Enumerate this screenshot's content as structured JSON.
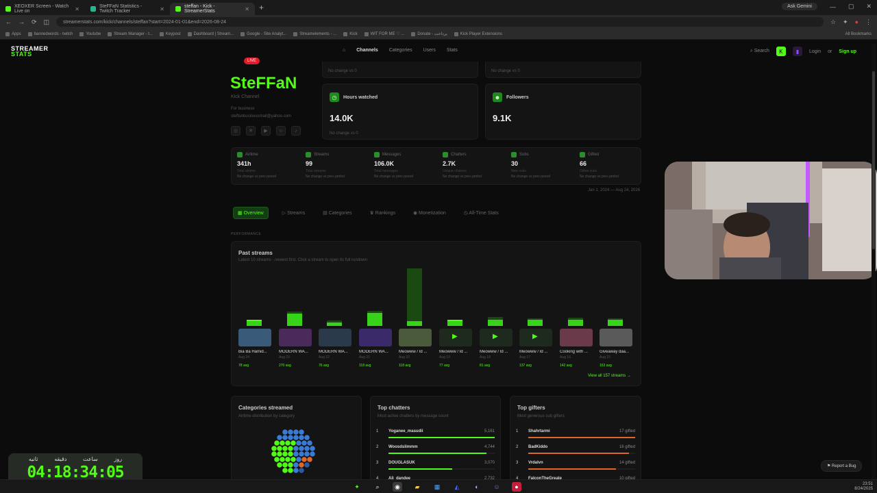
{
  "browser": {
    "tabs": [
      {
        "title": "XEOXER Screen - Watch Live on",
        "color": "#53fc18",
        "active": false
      },
      {
        "title": "SteFFaN Statistics - Twitch Tracker",
        "color": "#2bb58f",
        "active": false
      },
      {
        "title": "steffan - Kick - StreamerStats",
        "color": "#53fc18",
        "active": true
      }
    ],
    "new_tab": "+",
    "ask_gemini": "Ask Gemini",
    "url": "streamerstats.com/kick/channels/steffan?start=2024-01-01&end=2026-08-24",
    "bookmarks": [
      "Apps",
      "bannedwords - twitch",
      "Youtube",
      "Stream Manager - t...",
      "Keypost",
      "Dashboard | Stream...",
      "Google - Site Analyt...",
      "Streamelements - ...",
      "Kick",
      "WIT FOR ME ♡ ...",
      "Donate - پرداخت",
      "Kick Player Extensions"
    ],
    "all_bookmarks": "All Bookmarks"
  },
  "site": {
    "logo_line1": "STREAMER",
    "logo_line2": "STATS",
    "nav": [
      "Channels",
      "Categories",
      "Users",
      "Stats"
    ],
    "search": "Search",
    "login": "Login",
    "or": "or",
    "signup": "Sign up"
  },
  "channel": {
    "live_badge": "LIVE",
    "name": "SteFFaN",
    "subtitle": "Kick Channel",
    "business_label": "For business",
    "business_email": "steffanbusinessmail@yahoo.com"
  },
  "cards": {
    "top_left_nc": "No change vs 0",
    "top_right_nc": "No change vs 0",
    "hours_label": "Hours watched",
    "hours_value": "14.0K",
    "hours_nc": "No change vs 0",
    "followers_label": "Followers",
    "followers_value": "9.1K"
  },
  "stats": [
    {
      "label": "Airtime",
      "value": "341h",
      "sub": "Total airtime",
      "change": "No change vs prev period"
    },
    {
      "label": "Streams",
      "value": "99",
      "sub": "Total streams",
      "change": "No change vs prev period"
    },
    {
      "label": "Messages",
      "value": "106.0K",
      "sub": "Total messages",
      "change": "No change vs prev period"
    },
    {
      "label": "Chatters",
      "value": "2.7K",
      "sub": "Unique chatters",
      "change": "No change vs prev period"
    },
    {
      "label": "Subs",
      "value": "30",
      "sub": "New subs",
      "change": "No change vs prev period"
    },
    {
      "label": "Gifted",
      "value": "66",
      "sub": "Gifted subs",
      "change": "No change vs prev period"
    }
  ],
  "date_range": "Jan 1, 2024 — Aug 24, 2026",
  "section_tabs": [
    "Overview",
    "Streams",
    "Categories",
    "Rankings",
    "Monetization",
    "All-Time Stats"
  ],
  "performance_label": "PERFORMANCE",
  "past_streams": {
    "title": "Past streams",
    "subtitle": "Latest 10 streams · newest first. Click a stream to open its full rundown",
    "view_all": "View all 157 streams →",
    "streams": [
      {
        "title": "Bia Ba Hamid...",
        "date": "Aug 24",
        "avg": "78 avg",
        "bar": 0.1,
        "peak": 0.0,
        "thumb": "#3a5a7a",
        "play": false
      },
      {
        "title": "MODERN WA...",
        "date": "Aug 23",
        "avg": "270 avg",
        "bar": 0.22,
        "peak": 0.03,
        "thumb": "#4a2a5a",
        "play": false
      },
      {
        "title": "MODERN WA...",
        "date": "Aug 22",
        "avg": "76 avg",
        "bar": 0.08,
        "peak": 0.03,
        "thumb": "#2a3a4a",
        "play": false
      },
      {
        "title": "MODERN WA...",
        "date": "Aug 21",
        "avg": "118 avg",
        "bar": 0.23,
        "peak": 0.03,
        "thumb": "#3a2a6a",
        "play": false
      },
      {
        "title": "Meowww / Id ...",
        "date": "Aug 20",
        "avg": "118 avg",
        "bar": 0.1,
        "peak": 0.86,
        "thumb": "#4a5a3a",
        "play": false
      },
      {
        "title": "Meowww / Id ...",
        "date": "Aug 19",
        "avg": "77 avg",
        "bar": 0.1,
        "peak": 0.0,
        "thumb": "#1f2a1f",
        "play": true
      },
      {
        "title": "Meowww / Id ...",
        "date": "Aug 18",
        "avg": "81 avg",
        "bar": 0.12,
        "peak": 0.04,
        "thumb": "#1f2a1f",
        "play": true
      },
      {
        "title": "Meowww / Id ...",
        "date": "Aug 17",
        "avg": "137 avg",
        "bar": 0.12,
        "peak": 0.02,
        "thumb": "#1f2a1f",
        "play": true
      },
      {
        "title": "Cooking with ...",
        "date": "Aug 16",
        "avg": "142 avg",
        "bar": 0.12,
        "peak": 0.03,
        "thumb": "#6a3a4a",
        "play": false
      },
      {
        "title": "Giveaway daa...",
        "date": "Aug 15",
        "avg": "153 avg",
        "bar": 0.12,
        "peak": 0.02,
        "thumb": "#5a5a5a",
        "play": false
      }
    ]
  },
  "categories_streamed": {
    "title": "Categories streamed",
    "subtitle": "Airtime distribution by category"
  },
  "top_chatters": {
    "title": "Top chatters",
    "subtitle": "Most active chatters by message count",
    "items": [
      {
        "rank": "1",
        "name": "Yoganee_masudii",
        "value": "5,161",
        "fill": 1.0
      },
      {
        "rank": "2",
        "name": "Woosdslimmm",
        "value": "4,744",
        "fill": 0.92
      },
      {
        "rank": "3",
        "name": "DOUGLASUK",
        "value": "3,070",
        "fill": 0.6
      },
      {
        "rank": "4",
        "name": "Ali_dandee",
        "value": "2,732",
        "fill": 0.53
      }
    ]
  },
  "top_gifters": {
    "title": "Top gifters",
    "subtitle": "Most generous sub gifters",
    "items": [
      {
        "rank": "1",
        "name": "Shahrtarmi",
        "value": "17 gifted",
        "fill": 1.0
      },
      {
        "rank": "2",
        "name": "BadKiddo",
        "value": "16 gifted",
        "fill": 0.94
      },
      {
        "rank": "3",
        "name": "Vrdalvn",
        "value": "14 gifted",
        "fill": 0.82
      },
      {
        "rank": "4",
        "name": "FalconTheGreate",
        "value": "10 gifted",
        "fill": 0.6
      }
    ]
  },
  "timer": {
    "labels": [
      "روز",
      "ساعت",
      "دقیقه",
      "ثانیه"
    ],
    "value": "04:18:34:05"
  },
  "report_bug": "Report a Bug",
  "clock": {
    "time": "23:51",
    "date": "8/24/2025"
  },
  "colors": {
    "accent": "#53fc18",
    "gifter_bar": "#e0662a"
  }
}
